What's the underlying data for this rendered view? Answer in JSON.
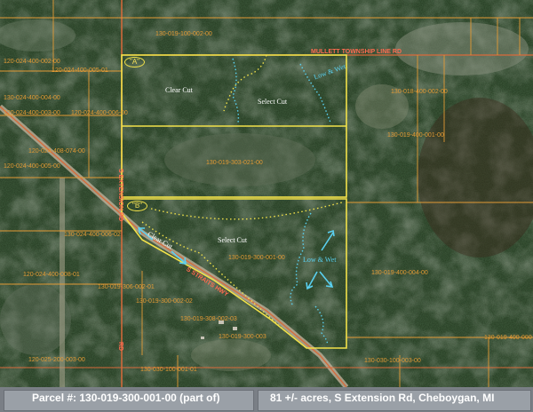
{
  "colors": {
    "forest": "#21361f",
    "boundary": "#f2e14a",
    "parcel_line": "#e39a35",
    "road": "#d96a3a",
    "wet_arrow": "#5ad0f0",
    "footer_bg": "#7a7f86"
  },
  "footer": {
    "parcel_number": "Parcel #: 130-019-300-001-00 (part of)",
    "description": "81 +/- acres, S Extension Rd, Cheboygan, MI"
  },
  "markers": {
    "a": "\"A\"",
    "b": "\"B\""
  },
  "areas": {
    "clear_cut_north": "Clear Cut",
    "select_cut_north": "Select Cut",
    "low_wet_north": "Low & Wet",
    "clear_cut_south": "Clear Cut",
    "select_cut_south": "Select Cut",
    "low_wet_south": "Low & Wet"
  },
  "roads": {
    "township_line": "MULLETT TOWNSHIP LINE RD",
    "extension_rd": "S EXTENSION RD",
    "us_highway": "S STRAITS HWY",
    "bottom_rd": "RD"
  },
  "parcels": [
    "130-019-100-002-00",
    "120-024-400-002-00",
    "120-024-400-005-01",
    "130-024-400-004-00",
    "120-024-400-003-00",
    "120-024-400-006-00",
    "120-024-408-074-00",
    "120-024-400-005-00",
    "130-019-303-021-00",
    "130-018-400-002-00",
    "130-019-400-001-00",
    "130-024-400-006-02",
    "120-024-400-008-01",
    "130-019-306-002-01",
    "130-019-300-001-00",
    "130-019-400-004-00",
    "130-019-300-002-02",
    "130-019-308-002-03",
    "130-019-300-003",
    "130-019-400-000",
    "120-025-200-003-00",
    "130-030-100-001-01",
    "130-030-100-003-00"
  ]
}
